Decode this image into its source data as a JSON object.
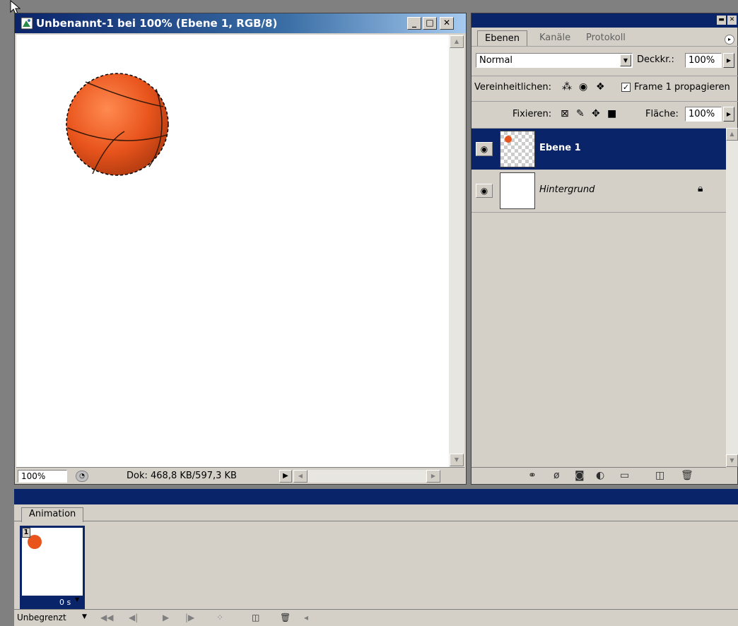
{
  "document": {
    "title": "Unbenannt-1 bei 100% (Ebene 1, RGB/8)",
    "zoom": "100%",
    "doc_info": "Dok: 468,8 KB/597,3 KB"
  },
  "window_buttons": {
    "minimize": "_",
    "maximize": "□",
    "close": "✕"
  },
  "layers_panel": {
    "tabs": [
      "Ebenen",
      "Kanäle",
      "Protokoll"
    ],
    "active_tab": "Ebenen",
    "blend_mode": "Normal",
    "opacity_label": "Deckkr.:",
    "opacity_value": "100%",
    "unify_label": "Vereinheitlichen:",
    "propagate_label": "Frame 1 propagieren",
    "lock_label": "Fixieren:",
    "fill_label": "Fläche:",
    "fill_value": "100%",
    "layers": [
      {
        "name": "Ebene 1",
        "selected": true,
        "visible": true
      },
      {
        "name": "Hintergrund",
        "selected": false,
        "visible": true,
        "locked": true
      }
    ]
  },
  "animation_panel": {
    "tab": "Animation",
    "frames": [
      {
        "number": "1",
        "delay": "0 s"
      }
    ],
    "loop": "Unbegrenzt"
  },
  "colors": {
    "selection": "#0a246a",
    "ball": "#e8541c",
    "panel_bg": "#d4d0c8"
  }
}
